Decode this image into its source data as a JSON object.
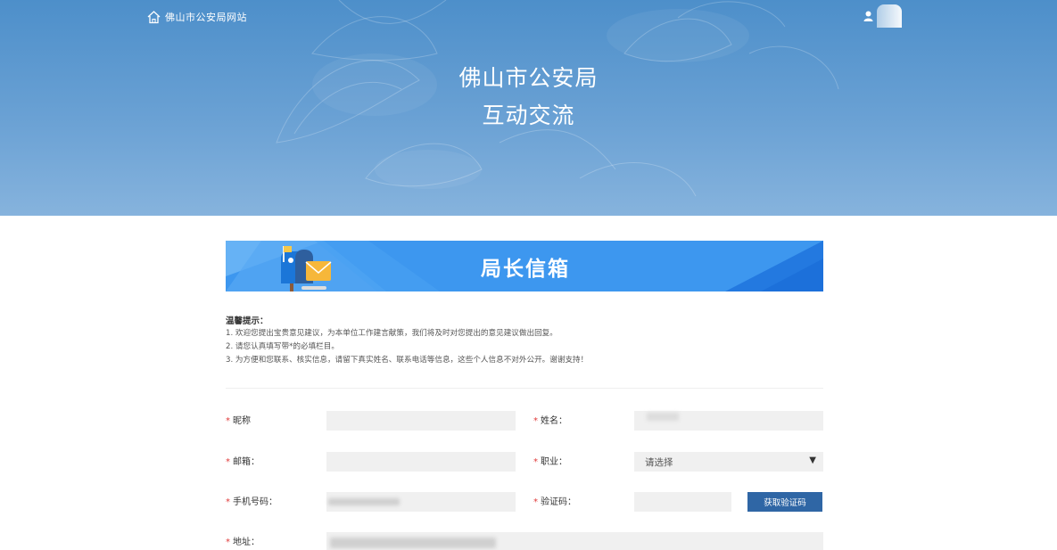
{
  "topbar": {
    "home_label": "佛山市公安局网站"
  },
  "hero": {
    "title_line1": "佛山市公安局",
    "title_line2": "互动交流"
  },
  "banner": {
    "title": "局长信箱"
  },
  "tips": {
    "title": "温馨提示：",
    "lines": [
      "1. 欢迎您提出宝贵意见建议，为本单位工作建言献策，我们将及时对您提出的意见建议做出回复。",
      "2. 请您认真填写带*的必填栏目。",
      "3. 为方便和您联系、核实信息，请留下真实姓名、联系电话等信息，这些个人信息不对外公开。谢谢支持！"
    ]
  },
  "form": {
    "required_mark": "*",
    "nickname_label": "昵称",
    "name_label": "姓名：",
    "email_label": "邮箱：",
    "occupation_label": "职业：",
    "occupation_value": "请选择",
    "phone_label": "手机号码：",
    "code_label": "验证码：",
    "get_code_button": "获取验证码",
    "address_label": "地址："
  },
  "icons": {
    "home": "home-icon",
    "user": "user-icon",
    "mailbox": "mailbox-icon",
    "dropdown": "triangle-down-icon"
  },
  "colors": {
    "hero_top": "#4d8fca",
    "banner_blue": "#3a95ef",
    "button_blue": "#2f66a5",
    "required_red": "#e03a3a"
  }
}
